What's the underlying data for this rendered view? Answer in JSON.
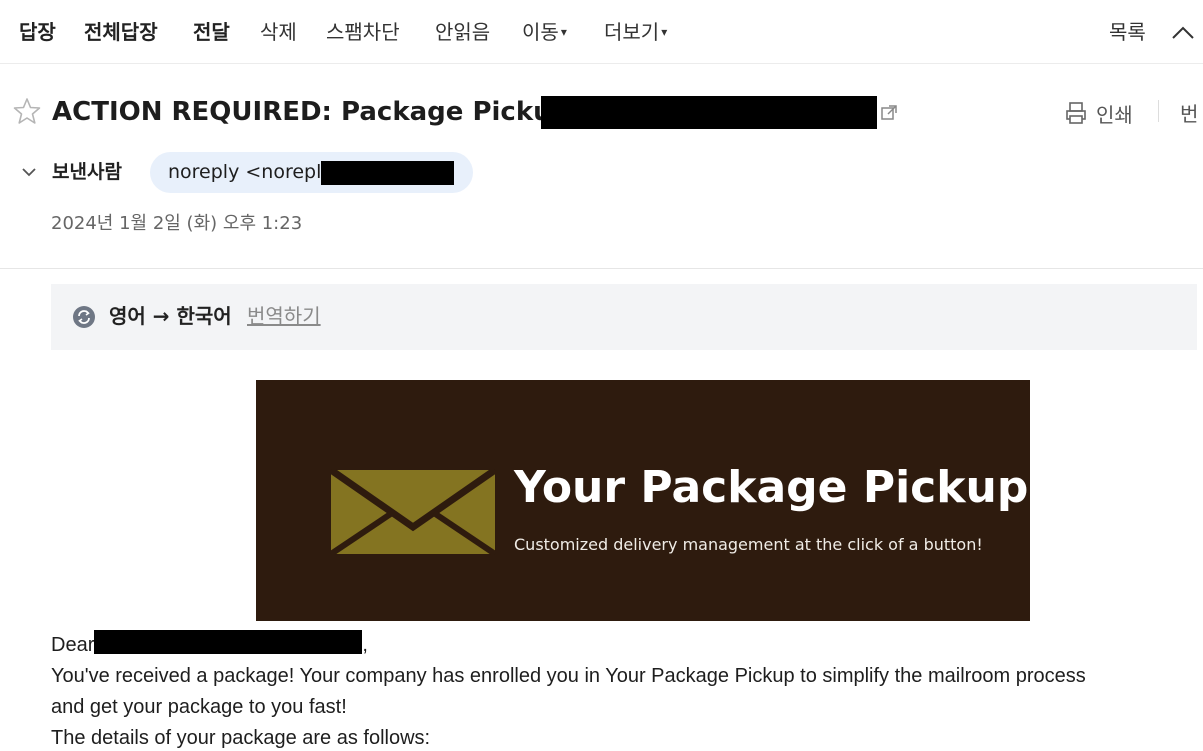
{
  "toolbar": {
    "reply": "답장",
    "reply_all": "전체답장",
    "forward": "전달",
    "delete": "삭제",
    "block_spam": "스팸차단",
    "mark_unread": "안읽음",
    "move": "이동",
    "more": "더보기",
    "caret": "▾",
    "list": "목록"
  },
  "mail": {
    "subject": "ACTION REQUIRED: Package Pickup for",
    "print_label": "인쇄",
    "cutoff_label": "번",
    "from_label": "보낸사람",
    "sender_text": "noreply <noreply",
    "date": "2024년 1월 2일 (화) 오후 1:23"
  },
  "translate": {
    "langs": "영어 → 한국어",
    "link": "번역하기"
  },
  "banner": {
    "title": "Your Package Pickup",
    "subtitle": "Customized delivery management at the click of a button!",
    "bg_color": "#2e1b0e",
    "envelope_color": "#847421"
  },
  "body": {
    "greeting": "Dear",
    "greeting_end": ",",
    "line1": "You've received a package! Your company has enrolled you in Your Package Pickup to simplify the mailroom process",
    "line2": "and get your package to you fast!",
    "line3": "The details of your package are as follows:"
  }
}
